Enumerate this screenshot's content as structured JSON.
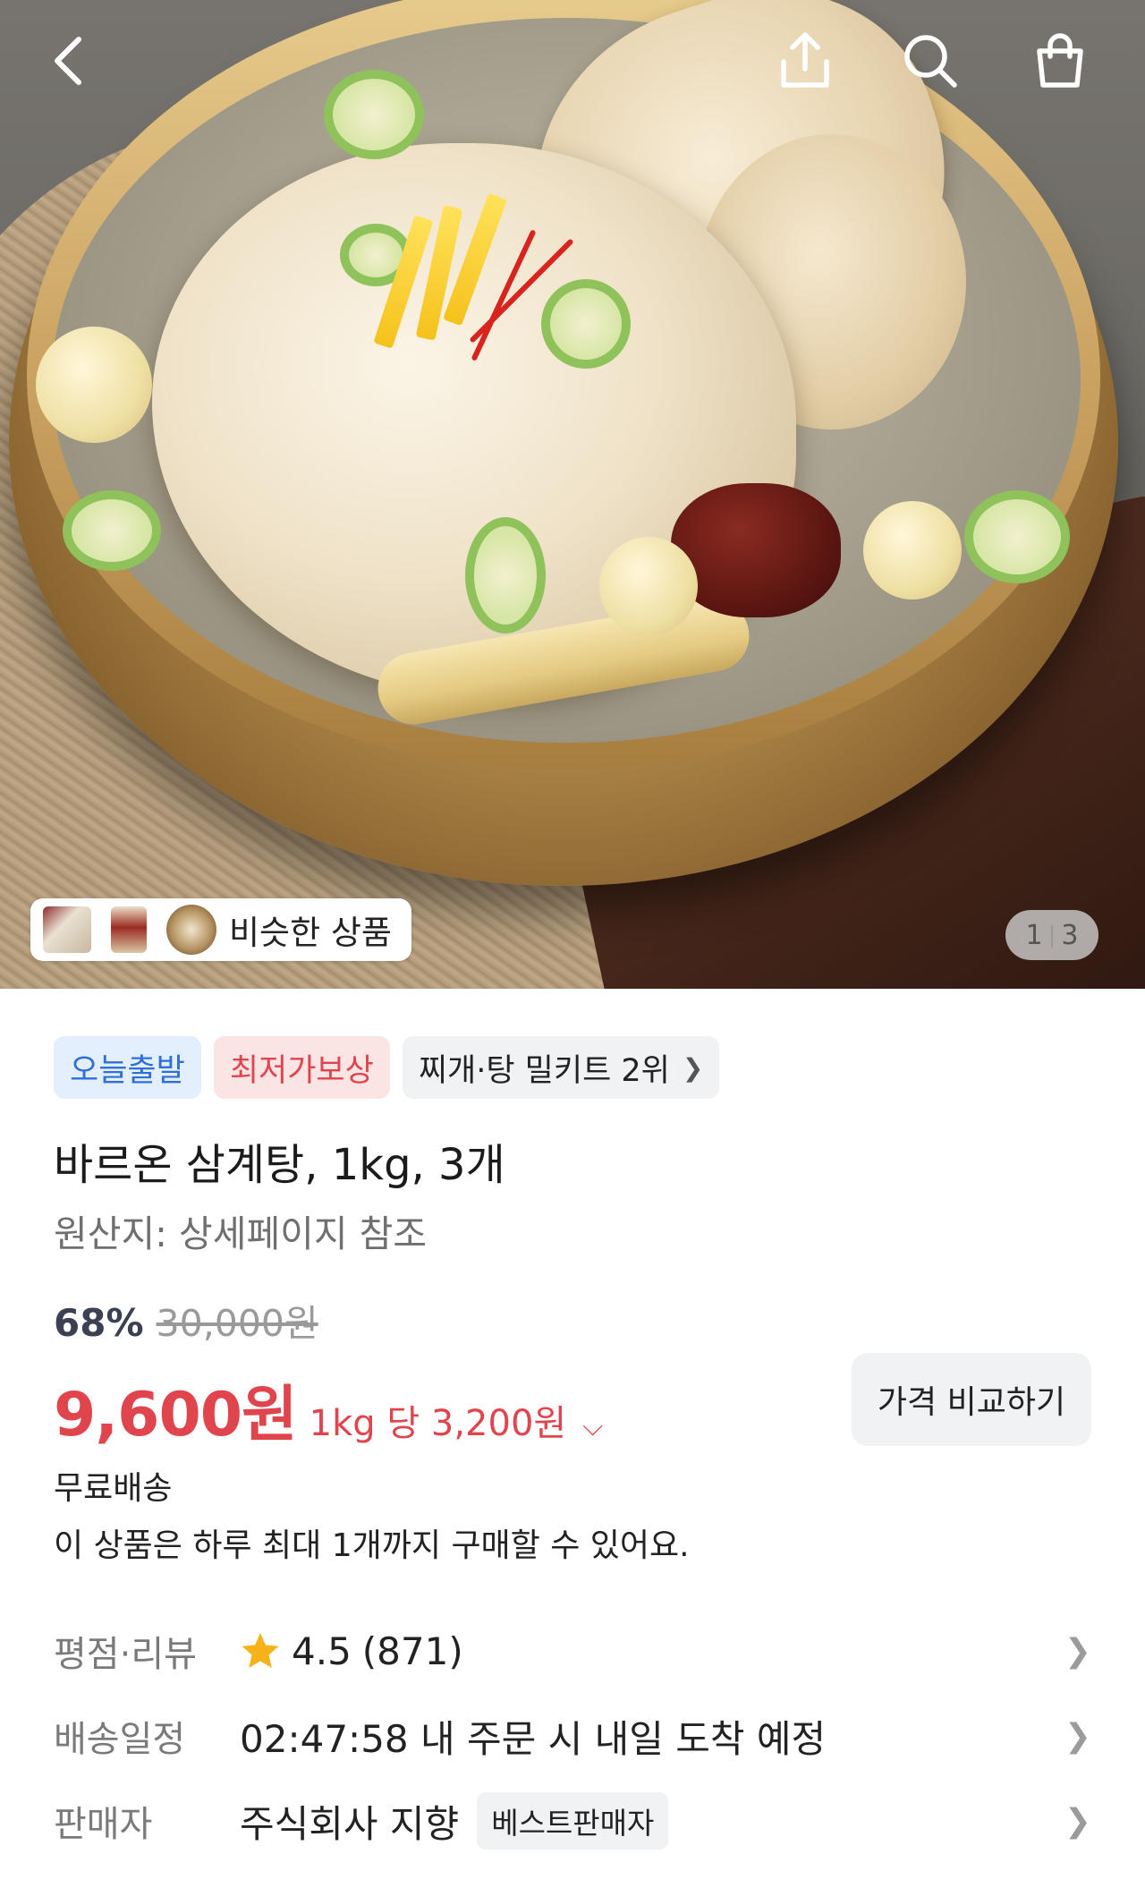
{
  "header": {
    "back_icon": "chevron-left-icon",
    "share_icon": "share-icon",
    "search_icon": "search-icon",
    "cart_icon": "shopping-bag-icon"
  },
  "gallery": {
    "similar_label": "비슷한 상품",
    "current_page": "1",
    "total_pages": "3"
  },
  "badges": {
    "today_ship": "오늘출발",
    "lowest_price": "최저가보상",
    "ranking": "찌개·탕 밀키트 2위"
  },
  "product": {
    "title": "바르온 삼계탕, 1kg, 3개",
    "origin": "원산지: 상세페이지 참조"
  },
  "price": {
    "discount": "68%",
    "original": "30,000원",
    "sale": "9,600원",
    "unit_price": "1kg 당 3,200원",
    "compare_button": "가격 비교하기"
  },
  "shipping": {
    "free": "무료배송",
    "limit": "이 상품은 하루 최대 1개까지 구매할 수 있어요."
  },
  "details": {
    "rating_label": "평점·리뷰",
    "rating_value": "4.5",
    "review_count": "(871)",
    "delivery_label": "배송일정",
    "delivery_value": "02:47:58 내 주문 시 내일 도착 예정",
    "seller_label": "판매자",
    "seller_name": "주식회사 지향",
    "seller_badge": "베스트판매자"
  },
  "colors": {
    "accent_red": "#e0454e",
    "accent_blue": "#2f6fd8",
    "star": "#f6b21b"
  }
}
